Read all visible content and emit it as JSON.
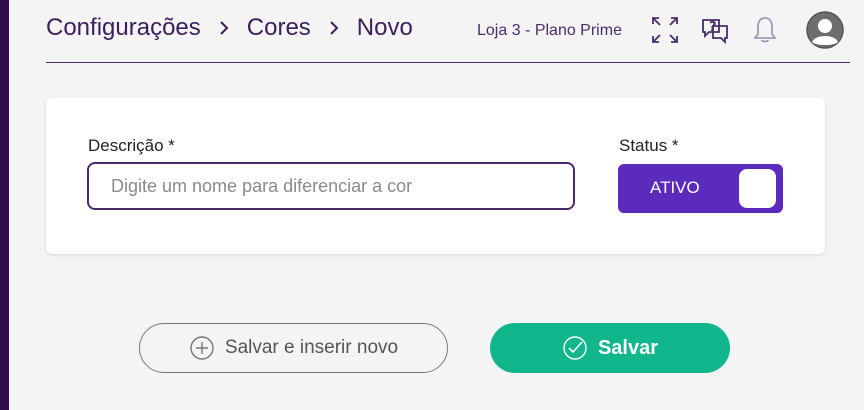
{
  "breadcrumb": {
    "items": [
      {
        "label": "Configurações"
      },
      {
        "label": "Cores"
      },
      {
        "label": "Novo"
      }
    ]
  },
  "header": {
    "store": "Loja 3 - Plano Prime",
    "icons": [
      "expand-icon",
      "help-chat-icon",
      "bell-icon",
      "user-avatar-icon"
    ]
  },
  "form": {
    "description_label": "Descrição *",
    "description_placeholder": "Digite um nome para diferenciar a cor",
    "description_value": "",
    "status_label": "Status *",
    "status_value": "ATIVO",
    "status_on": true
  },
  "actions": {
    "save_and_new_label": "Salvar e inserir novo",
    "save_label": "Salvar"
  },
  "colors": {
    "sidebar": "#2f0f4b",
    "brand": "#3b1f5a",
    "toggle": "#5b2bbd",
    "primary": "#12b68c"
  }
}
